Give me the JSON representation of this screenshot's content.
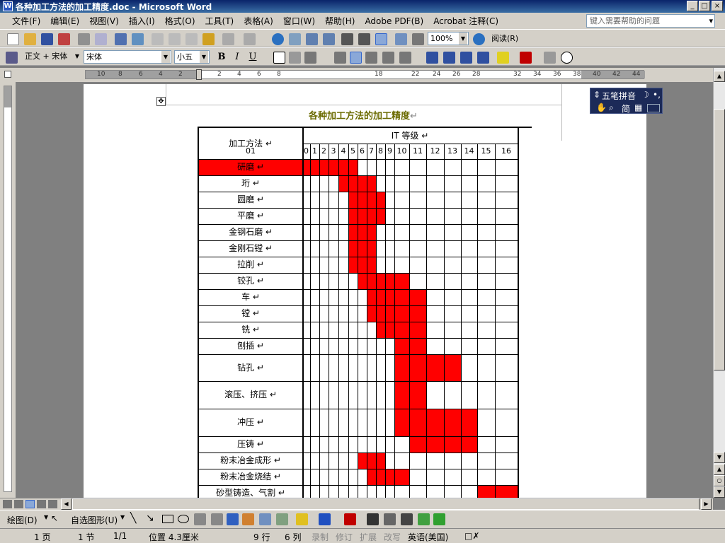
{
  "window": {
    "title": "各种加工方法的加工精度.doc - Microsoft Word",
    "icon": "W"
  },
  "menu": [
    "文件(F)",
    "编辑(E)",
    "视图(V)",
    "插入(I)",
    "格式(O)",
    "工具(T)",
    "表格(A)",
    "窗口(W)",
    "帮助(H)",
    "Adobe PDF(B)",
    "Acrobat 注释(C)"
  ],
  "help_box": {
    "placeholder": "键入需要帮助的问题"
  },
  "toolbar": {
    "zoom": "100%",
    "read_label": "阅读(R)"
  },
  "format_bar": {
    "style": "正文 + 宋体",
    "font": "宋体",
    "size": "小五",
    "bold": "B",
    "italic": "I",
    "underline": "U"
  },
  "ruler_labels": [
    "10",
    "8",
    "6",
    "4",
    "2",
    "2",
    "4",
    "6",
    "8",
    "18",
    "22",
    "24",
    "26",
    "28",
    "32",
    "34",
    "36",
    "38",
    "40",
    "42",
    "44"
  ],
  "ime": {
    "name": "五笔拼音",
    "mode": "简"
  },
  "document": {
    "title": "各种加工方法的加工精度",
    "header_method": "加工方法",
    "header_it": "IT 等级",
    "it_levels": [
      "01",
      "0",
      "1",
      "2",
      "3",
      "4",
      "5",
      "6",
      "7",
      "8",
      "9",
      "10",
      "11",
      "12",
      "13",
      "14",
      "15",
      "16"
    ],
    "rows": [
      {
        "method": "研磨",
        "from": 0,
        "to": 7
      },
      {
        "method": "珩",
        "from": 5,
        "to": 9
      },
      {
        "method": "圆磨",
        "from": 6,
        "to": 10
      },
      {
        "method": "平磨",
        "from": 6,
        "to": 10
      },
      {
        "method": "金钢石磨",
        "from": 6,
        "to": 9
      },
      {
        "method": "金刚石镗",
        "from": 6,
        "to": 9
      },
      {
        "method": "拉削",
        "from": 6,
        "to": 9
      },
      {
        "method": "铰孔",
        "from": 7,
        "to": 12
      },
      {
        "method": "车",
        "from": 8,
        "to": 13
      },
      {
        "method": "镗",
        "from": 8,
        "to": 13
      },
      {
        "method": "铣",
        "from": 9,
        "to": 13
      },
      {
        "method": "刨插",
        "from": 11,
        "to": 13
      },
      {
        "method": "钻孔",
        "from": 11,
        "to": 15
      },
      {
        "method": "滚压、挤压",
        "from": 11,
        "to": 13
      },
      {
        "method": "冲压",
        "from": 11,
        "to": 16
      },
      {
        "method": "压铸",
        "from": 12,
        "to": 16
      },
      {
        "method": "粉末冶金成形",
        "from": 7,
        "to": 10
      },
      {
        "method": "粉末冶金烧结",
        "from": 8,
        "to": 12
      },
      {
        "method": "砂型铸造、气割",
        "from": 16,
        "to": 18
      }
    ],
    "bar_color": "#ff0000"
  },
  "drawing_bar": {
    "draw_label": "绘图(D)",
    "autoshape_label": "自选图形(U)"
  },
  "status": {
    "page": "1 页",
    "section": "1 节",
    "page_of": "1/1",
    "position": "位置 4.3厘米",
    "line": "9 行",
    "col": "6 列",
    "rec": "录制",
    "trk": "修订",
    "ext": "扩展",
    "ovr": "改写",
    "lang": "英语(美国)"
  }
}
